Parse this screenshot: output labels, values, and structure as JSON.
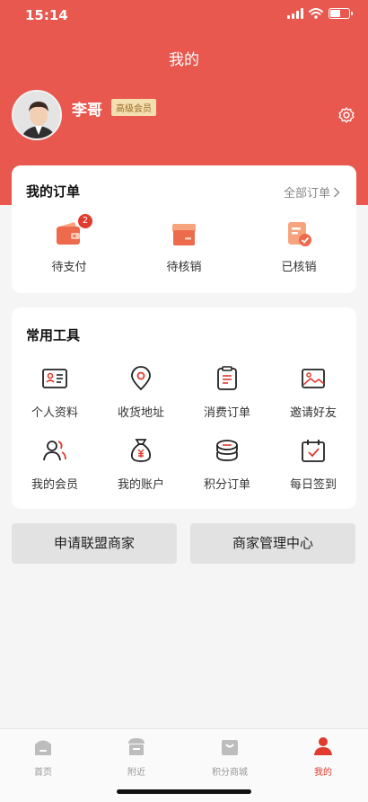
{
  "status_bar": {
    "time": "15:14"
  },
  "header": {
    "title": "我的"
  },
  "profile": {
    "name": "李哥",
    "member_level": "高级会员"
  },
  "orders": {
    "title": "我的订单",
    "all_label": "全部订单",
    "items": [
      {
        "label": "待支付",
        "icon": "wallet-icon",
        "badge": "2"
      },
      {
        "label": "待核销",
        "icon": "box-icon"
      },
      {
        "label": "已核销",
        "icon": "checked-receipt-icon"
      }
    ]
  },
  "tools": {
    "title": "常用工具",
    "items": [
      {
        "label": "个人资料",
        "icon": "id-card-icon"
      },
      {
        "label": "收货地址",
        "icon": "location-pin-icon"
      },
      {
        "label": "消费订单",
        "icon": "clipboard-icon"
      },
      {
        "label": "邀请好友",
        "icon": "picture-icon"
      },
      {
        "label": "我的会员",
        "icon": "users-icon"
      },
      {
        "label": "我的账户",
        "icon": "money-bag-icon"
      },
      {
        "label": "积分订单",
        "icon": "coins-icon"
      },
      {
        "label": "每日签到",
        "icon": "calendar-check-icon"
      }
    ]
  },
  "actions": {
    "apply_merchant": "申请联盟商家",
    "merchant_center": "商家管理中心"
  },
  "tabbar": {
    "items": [
      {
        "label": "首页",
        "icon": "home-icon"
      },
      {
        "label": "附近",
        "icon": "store-icon"
      },
      {
        "label": "积分商城",
        "icon": "shopping-bag-icon"
      },
      {
        "label": "我的",
        "icon": "person-icon",
        "active": true
      }
    ]
  },
  "colors": {
    "brand": "#e9584e",
    "accent": "#e03b2f",
    "badge_bg": "#f4dfb0"
  }
}
